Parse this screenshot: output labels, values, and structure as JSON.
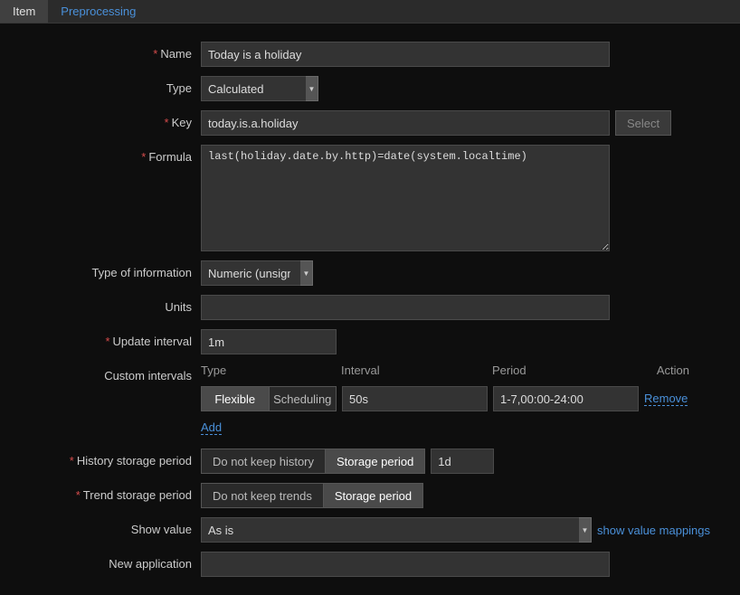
{
  "tabs": {
    "item": "Item",
    "preprocessing": "Preprocessing"
  },
  "labels": {
    "name": "Name",
    "type": "Type",
    "key": "Key",
    "formula": "Formula",
    "type_of_information": "Type of information",
    "units": "Units",
    "update_interval": "Update interval",
    "custom_intervals": "Custom intervals",
    "history_storage_period": "History storage period",
    "trend_storage_period": "Trend storage period",
    "show_value": "Show value",
    "new_application": "New application"
  },
  "values": {
    "name": "Today is a holiday",
    "type": "Calculated",
    "key": "today.is.a.holiday",
    "formula": "last(holiday.date.by.http)=date(system.localtime)",
    "type_of_information": "Numeric (unsigned)",
    "units": "",
    "update_interval": "1m",
    "history_value": "1d",
    "show_value": "As is",
    "new_application": ""
  },
  "buttons": {
    "select": "Select",
    "add": "Add",
    "remove": "Remove",
    "show_value_mappings": "show value mappings"
  },
  "custom_intervals": {
    "headers": {
      "type": "Type",
      "interval": "Interval",
      "period": "Period",
      "action": "Action"
    },
    "segments": {
      "flexible": "Flexible",
      "scheduling": "Scheduling"
    },
    "row": {
      "interval": "50s",
      "period": "1-7,00:00-24:00"
    }
  },
  "history": {
    "do_not_keep": "Do not keep history",
    "storage_period": "Storage period"
  },
  "trend": {
    "do_not_keep": "Do not keep trends",
    "storage_period": "Storage period"
  }
}
